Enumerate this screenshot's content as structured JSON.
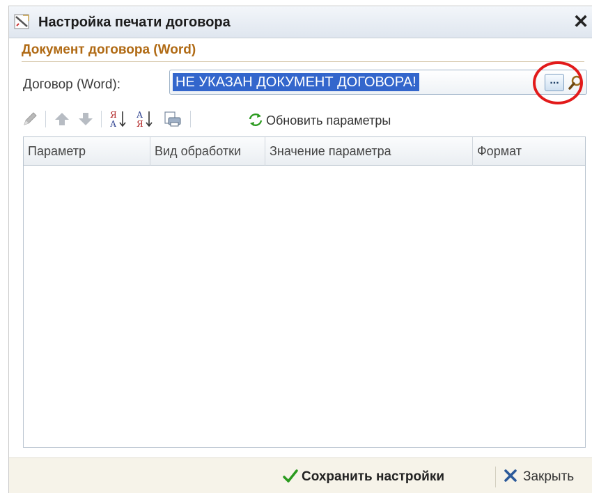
{
  "window": {
    "title": "Настройка печати договора",
    "close_glyph": "✕",
    "icon": "pencil-ruler-icon"
  },
  "group": {
    "title": "Документ договора (Word)"
  },
  "document_field": {
    "label": "Договор (Word):",
    "value": "НЕ УКАЗАН ДОКУМЕНТ ДОГОВОРА!",
    "choose_label": "...",
    "search_icon": "magnifier-icon"
  },
  "toolbar": {
    "items": [
      "edit-icon",
      "move-up-icon",
      "move-down-icon",
      "sort-desc-icon",
      "sort-asc-icon",
      "print-preview-icon",
      "refresh-icon"
    ],
    "refresh_label": "Обновить параметры"
  },
  "grid": {
    "columns": [
      "Параметр",
      "Вид обработки",
      "Значение параметра",
      "Формат"
    ],
    "rows": []
  },
  "footer": {
    "save_label": "Сохранить настройки",
    "close_label": "Закрыть"
  },
  "colors": {
    "accent_orange": "#b06a14",
    "selection_blue": "#3366cc",
    "highlight_red": "#e21a1a",
    "check_green": "#2a9a1e",
    "close_blue": "#2c5a9a"
  }
}
